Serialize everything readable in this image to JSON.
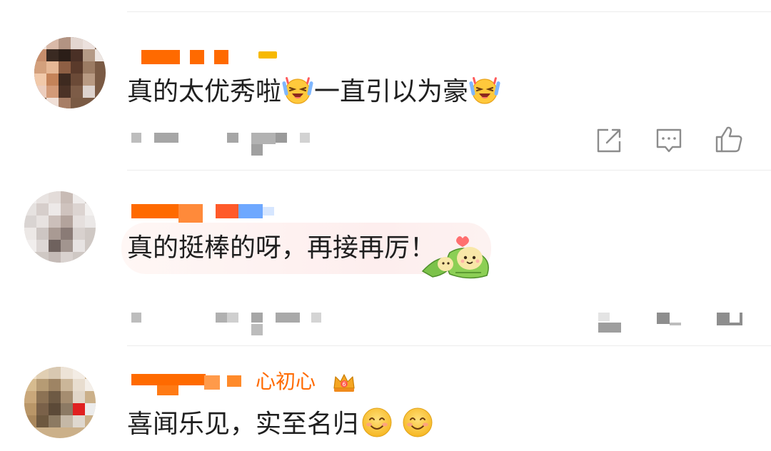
{
  "comments": [
    {
      "text_a": "真的太优秀啦",
      "text_b": "一直引以为豪",
      "emoji": "laughing-crying-emoji",
      "actions": [
        "share-icon",
        "reply-icon",
        "like-icon"
      ]
    },
    {
      "text": "真的挺棒的呀，再接再厉！",
      "sticker": "zongzi-couple-sticker"
    },
    {
      "name_tail": "心初心",
      "text": "喜闻乐见，实至名归",
      "emoji": "smile-emoji",
      "badge": "vip-crown-badge"
    }
  ],
  "colors": {
    "accent": "#ff6a00",
    "blue": "#6ea8ff",
    "gray_icon": "#8c8c8c",
    "divider": "#ececec"
  }
}
